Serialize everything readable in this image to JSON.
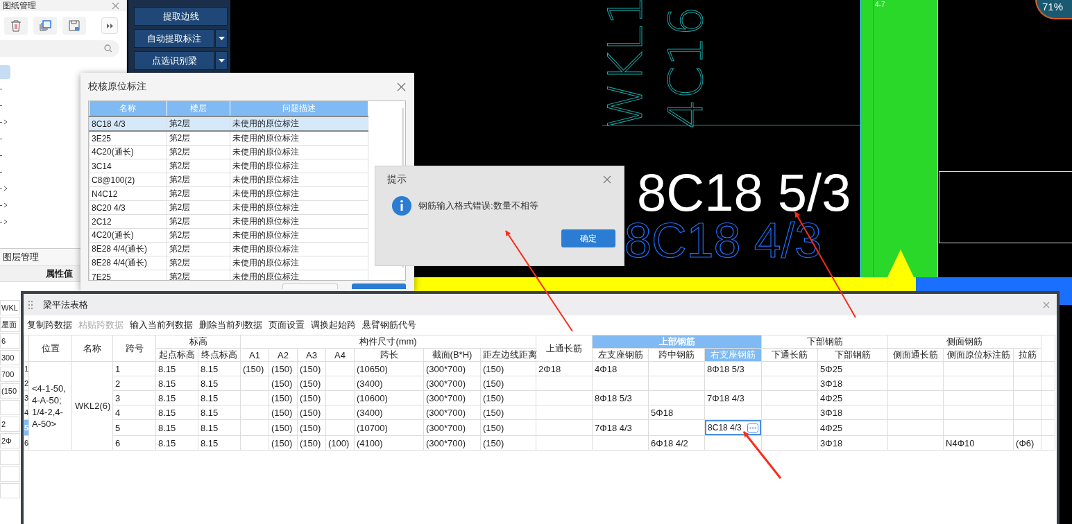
{
  "drawing_panel": {
    "title": "图纸管理",
    "tree": [
      {
        "selected": true,
        "expandable": false
      },
      {
        "selected": false,
        "expandable": false
      },
      {
        "selected": false,
        "expandable": false
      },
      {
        "selected": false,
        "expandable": true
      },
      {
        "selected": false,
        "expandable": false
      },
      {
        "selected": false,
        "expandable": false
      },
      {
        "selected": false,
        "expandable": false
      },
      {
        "selected": false,
        "expandable": true
      },
      {
        "selected": false,
        "expandable": true
      },
      {
        "selected": false,
        "expandable": true
      }
    ]
  },
  "layer_panel": {
    "title": "图层管理",
    "column": "属性值",
    "values": [
      {
        "kind": "text",
        "value": "WKL"
      },
      {
        "kind": "text",
        "value": "屋面"
      },
      {
        "kind": "text",
        "value": "6"
      },
      {
        "kind": "text",
        "value": "300"
      },
      {
        "kind": "text",
        "value": "700"
      },
      {
        "kind": "text",
        "value": "(150"
      },
      {
        "kind": "blank"
      },
      {
        "kind": "text",
        "value": "2"
      },
      {
        "kind": "text",
        "value": "2Φ"
      },
      {
        "kind": "blank"
      },
      {
        "kind": "blank"
      },
      {
        "kind": "blank"
      }
    ]
  },
  "tool_buttons": [
    {
      "label": "提取边线",
      "dropdown": false
    },
    {
      "label": "自动提取标注",
      "dropdown": true
    },
    {
      "label": "点选识别梁",
      "dropdown": true
    }
  ],
  "cad": {
    "vertical_texts": [
      "WKL1",
      "4C16"
    ],
    "axis_label": "4-7",
    "zoom_badge": "71%",
    "label_white": "8C18 5/3",
    "label_blue": "8C18 4/3"
  },
  "check_dialog": {
    "title": "校核原位标注",
    "columns": [
      "名称",
      "楼层",
      "问题描述"
    ],
    "rows": [
      {
        "cells": [
          "8C18 4/3",
          "第2层",
          "未使用的原位标注"
        ],
        "selected": true
      },
      {
        "cells": [
          "3E25",
          "第2层",
          "未使用的原位标注"
        ],
        "selected": false
      },
      {
        "cells": [
          "4C20(通长)",
          "第2层",
          "未使用的原位标注"
        ],
        "selected": false
      },
      {
        "cells": [
          "3C14",
          "第2层",
          "未使用的原位标注"
        ],
        "selected": false
      },
      {
        "cells": [
          "C8@100(2)",
          "第2层",
          "未使用的原位标注"
        ],
        "selected": false
      },
      {
        "cells": [
          "N4C12",
          "第2层",
          "未使用的原位标注"
        ],
        "selected": false
      },
      {
        "cells": [
          "8C20 4/3",
          "第2层",
          "未使用的原位标注"
        ],
        "selected": false
      },
      {
        "cells": [
          "2C12",
          "第2层",
          "未使用的原位标注"
        ],
        "selected": false
      },
      {
        "cells": [
          "4C20(通长)",
          "第2层",
          "未使用的原位标注"
        ],
        "selected": false
      },
      {
        "cells": [
          "8E28 4/4(通长)",
          "第2层",
          "未使用的原位标注"
        ],
        "selected": false
      },
      {
        "cells": [
          "8E28 4/4(通长)",
          "第2层",
          "未使用的原位标注"
        ],
        "selected": false
      },
      {
        "cells": [
          "7E25",
          "第2层",
          "未使用的原位标注"
        ],
        "selected": false
      }
    ]
  },
  "tip_dialog": {
    "title": "提示",
    "message": "钢筋输入格式错误:数量不相等",
    "button": "确定"
  },
  "beam_table": {
    "title": "梁平法表格",
    "toolbar": [
      {
        "label": "复制跨数据",
        "disabled": false
      },
      {
        "label": "粘贴跨数据",
        "disabled": true
      },
      {
        "label": "输入当前列数据",
        "disabled": false
      },
      {
        "label": "删除当前列数据",
        "disabled": false
      },
      {
        "label": "页面设置",
        "disabled": false
      },
      {
        "label": "调换起始跨",
        "disabled": false
      },
      {
        "label": "悬臂钢筋代号",
        "disabled": false
      }
    ],
    "header": [
      {
        "label": "位置",
        "selected": false
      },
      {
        "label": "名称",
        "selected": false
      },
      {
        "label": "跨号",
        "selected": false
      },
      {
        "label": "标高",
        "selected": false,
        "children": [
          {
            "label": "起点标高",
            "selected": false
          },
          {
            "label": "终点标高",
            "selected": false
          }
        ]
      },
      {
        "label": "构件尺寸(mm)",
        "selected": false,
        "children": [
          {
            "label": "A1",
            "selected": false
          },
          {
            "label": "A2",
            "selected": false
          },
          {
            "label": "A3",
            "selected": false
          },
          {
            "label": "A4",
            "selected": false
          },
          {
            "label": "跨长",
            "selected": false
          },
          {
            "label": "截面(B*H)",
            "selected": false
          },
          {
            "label": "距左边线距离",
            "selected": false
          }
        ]
      },
      {
        "label": "上通长筋",
        "selected": false
      },
      {
        "label": "上部钢筋",
        "selected": true,
        "children": [
          {
            "label": "左支座钢筋",
            "selected": false
          },
          {
            "label": "跨中钢筋",
            "selected": false
          },
          {
            "label": "右支座钢筋",
            "selected": true
          }
        ]
      },
      {
        "label": "下部钢筋",
        "selected": false,
        "children": [
          {
            "label": "下通长筋",
            "selected": false
          },
          {
            "label": "下部钢筋",
            "selected": false
          }
        ]
      },
      {
        "label": "侧面钢筋",
        "selected": false,
        "children": [
          {
            "label": "侧面通长筋",
            "selected": false
          },
          {
            "label": "侧面原位标注筋",
            "selected": false
          },
          {
            "label": "拉筋",
            "selected": false
          }
        ]
      }
    ],
    "position": "<4-1-50,4-A-50;1/4-2,4-A-50>",
    "name": "WKL2(6)",
    "rows": [
      {
        "number": "1",
        "selected": false,
        "cells": [
          "1",
          "8.15",
          "8.15",
          "(150)",
          "(150)",
          "(150)",
          "",
          "(10650)",
          "(300*700)",
          "(150)",
          "2Φ18",
          "4Φ18",
          "",
          "8Φ18 5/3",
          "",
          "5Φ25",
          "",
          "",
          ""
        ]
      },
      {
        "number": "2",
        "selected": false,
        "cells": [
          "2",
          "8.15",
          "8.15",
          "",
          "(150)",
          "(150)",
          "",
          "(3400)",
          "(300*700)",
          "(150)",
          "",
          "",
          "",
          "",
          "",
          "3Φ18",
          "",
          "",
          ""
        ]
      },
      {
        "number": "3",
        "selected": false,
        "cells": [
          "3",
          "8.15",
          "8.15",
          "",
          "(150)",
          "(150)",
          "",
          "(10600)",
          "(300*700)",
          "(150)",
          "",
          "8Φ18 5/3",
          "",
          "7Φ18 4/3",
          "",
          "4Φ25",
          "",
          "",
          ""
        ]
      },
      {
        "number": "4",
        "selected": false,
        "cells": [
          "4",
          "8.15",
          "8.15",
          "",
          "(150)",
          "(150)",
          "",
          "(3400)",
          "(300*700)",
          "(150)",
          "",
          "",
          "5Φ18",
          "",
          "",
          "3Φ18",
          "",
          "",
          ""
        ]
      },
      {
        "number": "5",
        "selected": true,
        "cells": [
          "5",
          "8.15",
          "8.15",
          "",
          "(150)",
          "(150)",
          "",
          "(10700)",
          "(300*700)",
          "(150)",
          "",
          "7Φ18 4/3",
          "",
          "8C18 4/3",
          "",
          "4Φ25",
          "",
          "",
          ""
        ]
      },
      {
        "number": "6",
        "selected": false,
        "cells": [
          "6",
          "8.15",
          "8.15",
          "",
          "(150)",
          "(150)",
          "(100)",
          "(4100)",
          "(300*700)",
          "(150)",
          "",
          "",
          "6Φ18 4/2",
          "",
          "",
          "3Φ18",
          "",
          "N4Φ10",
          "(Φ6)"
        ]
      }
    ]
  }
}
